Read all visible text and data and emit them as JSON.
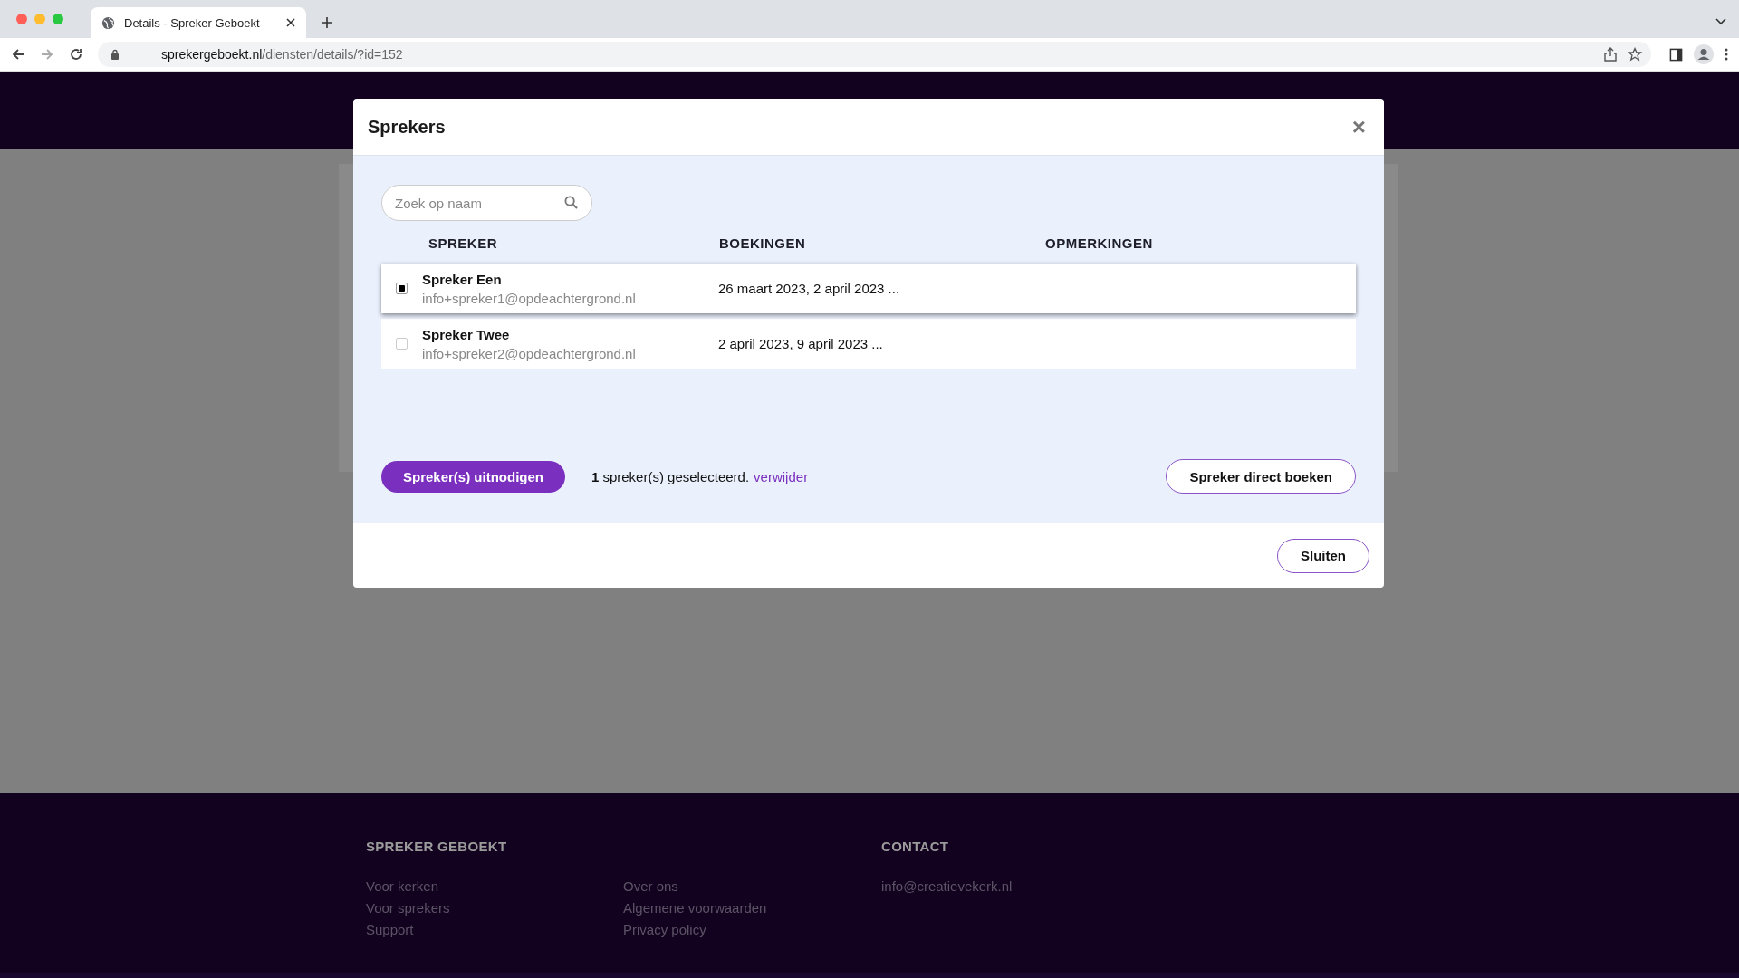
{
  "browser": {
    "tab_title": "Details - Spreker Geboekt",
    "url_domain": "sprekergeboekt.nl",
    "url_path": "/diensten/details/?id=152"
  },
  "modal": {
    "title": "Sprekers",
    "close_icon": "×",
    "search": {
      "placeholder": "Zoek op naam"
    },
    "columns": [
      "SPREKER",
      "BOEKINGEN",
      "OPMERKINGEN"
    ],
    "rows": [
      {
        "name": "Spreker Een",
        "email": "info+spreker1@opdeachtergrond.nl",
        "bookings": "26 maart 2023, 2 april 2023 ...",
        "checked": true
      },
      {
        "name": "Spreker Twee",
        "email": "info+spreker2@opdeachtergrond.nl",
        "bookings": "2 april 2023, 9 april 2023 ...",
        "checked": false
      }
    ],
    "invite_button": "Spreker(s) uitnodigen",
    "selection_count": "1",
    "selection_text": "spreker(s) geselecteerd.",
    "remove_link": "verwijder",
    "book_button": "Spreker direct boeken",
    "close_button": "Sluiten"
  },
  "footer": {
    "columns": [
      {
        "heading": "SPREKER GEBOEKT",
        "links": [
          "Voor kerken",
          "Voor sprekers",
          "Support"
        ]
      },
      {
        "links": [
          "Over ons",
          "Algemene voorwaarden",
          "Privacy policy"
        ]
      },
      {
        "heading": "CONTACT",
        "links": [
          "info@creatievekerk.nl"
        ]
      }
    ]
  }
}
